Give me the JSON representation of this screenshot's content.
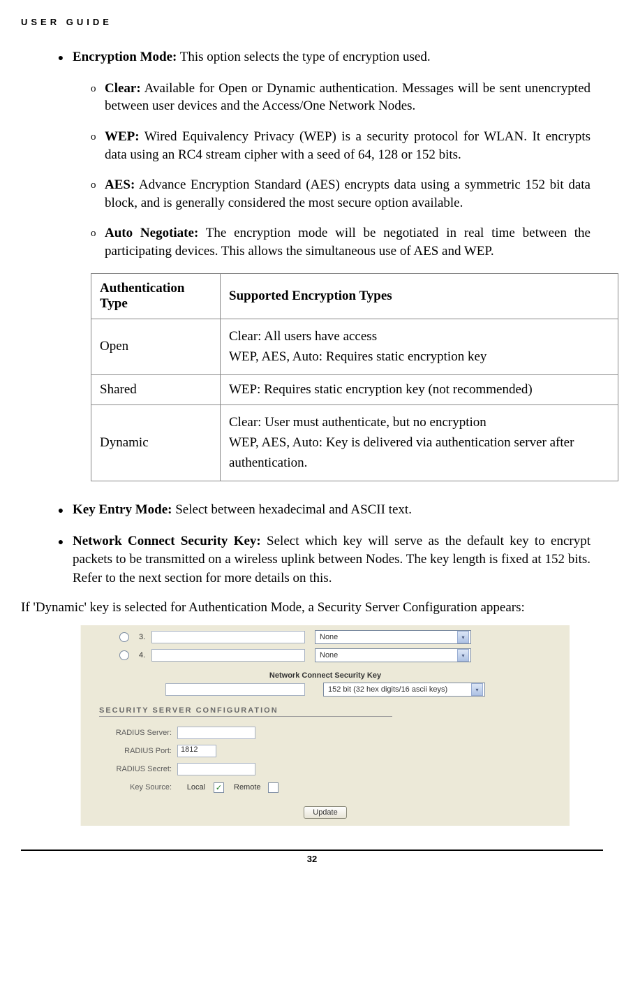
{
  "header": "USER GUIDE",
  "page_number": "32",
  "bullets": {
    "encryption_mode": {
      "label": "Encryption Mode:",
      "text": " This option selects the type of encryption used."
    },
    "key_entry": {
      "label": "Key Entry Mode:",
      "text": " Select between hexadecimal and ASCII text."
    },
    "nck": {
      "label": "Network Connect Security Key:",
      "text": " Select which key will serve as the default key to encrypt packets to be transmitted on a wireless uplink between Nodes. The key length is fixed at 152 bits. Refer to the next section for more details on this."
    }
  },
  "subs": {
    "clear": {
      "label": "Clear:",
      "text": " Available for Open or Dynamic authentication. Messages will be sent unencrypted between user devices and the Access/One Network Nodes."
    },
    "wep": {
      "label": "WEP:",
      "text": " Wired Equivalency Privacy (WEP) is a security protocol for WLAN. It encrypts data using an RC4 stream cipher with a seed of 64, 128 or 152 bits."
    },
    "aes": {
      "label": "AES:",
      "text": " Advance Encryption Standard (AES) encrypts data using a symmetric 152 bit data block, and is generally considered the most secure option available."
    },
    "auto": {
      "label": "Auto Negotiate:",
      "text": " The encryption mode will be negotiated in real time between the participating devices. This allows the simultaneous use of AES and WEP."
    }
  },
  "table": {
    "h1": "Authentication Type",
    "h2": "Supported Encryption Types",
    "r1c1": "Open",
    "r1c2a": "Clear: All users have access",
    "r1c2b": "WEP, AES, Auto: Requires static encryption key",
    "r2c1": "Shared",
    "r2c2": "WEP: Requires static encryption key (not recommended)",
    "r3c1": "Dynamic",
    "r3c2a": "Clear: User must authenticate, but no encryption",
    "r3c2b": "WEP, AES, Auto: Key is delivered via authentication server after authentication."
  },
  "dynamic_note": "If 'Dynamic' key is selected for Authentication Mode, a Security Server Configuration appears:",
  "ui": {
    "row3_num": "3.",
    "row4_num": "4.",
    "drop_none": "None",
    "nck_title": "Network Connect Security Key",
    "nck_drop": "152 bit (32 hex digits/16 ascii keys)",
    "sec_header": "SECURITY SERVER CONFIGURATION",
    "radius_server": "RADIUS Server:",
    "radius_port": "RADIUS Port:",
    "radius_port_val": "1812",
    "radius_secret": "RADIUS Secret:",
    "key_source": "Key Source:",
    "local": "Local",
    "remote": "Remote",
    "update": "Update"
  }
}
